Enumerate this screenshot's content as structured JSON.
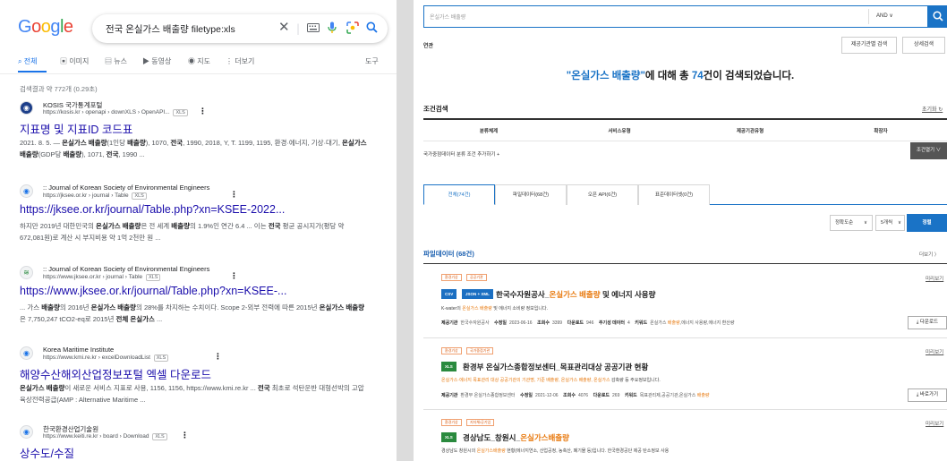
{
  "google": {
    "logo": "Google",
    "logo_colors": [
      "#4285f4",
      "#ea4335",
      "#fbbc05",
      "#4285f4",
      "#34a853",
      "#ea4335"
    ],
    "query": "전국 온실가스 배출량 filetype:xls",
    "icons": [
      "clear-icon",
      "keyboard-icon",
      "mic-icon",
      "lens-icon",
      "search-icon"
    ],
    "tabs": [
      {
        "icon": "search-icon",
        "glyph": "⌕",
        "label": "전체"
      },
      {
        "icon": "image-icon",
        "glyph": "▣",
        "label": "이미지"
      },
      {
        "icon": "news-icon",
        "glyph": "▤",
        "label": "뉴스"
      },
      {
        "icon": "video-icon",
        "glyph": "▶",
        "label": "동영상"
      },
      {
        "icon": "map-pin-icon",
        "glyph": "◉",
        "label": "지도"
      },
      {
        "icon": "more-dots-icon",
        "glyph": "⋮",
        "label": "더보기"
      },
      {
        "icon": "",
        "glyph": "",
        "label": "도구"
      }
    ],
    "stats": "검색결과 약 772개 (0.29초)",
    "results": [
      {
        "site": "KOSIS 국가통계포털",
        "url": "https://kosis.kr › openapi › downXLS › OpenAPI...",
        "filetype": "XLS",
        "title": "지표명 및 지표ID 코드표",
        "snippet_html": "2021. 8. 5. — <b>온실가스 배출량</b>(1인당 <b>배출량</b>), 1070, <b>전국</b>, 1990, 2018, Y, T. 1199, 1195, 환경·에너지, 기상·대기, <b>온실가스 배출량</b>(GDP당 <b>배출량</b>), 1071, <b>전국</b>, 1990 ..."
      },
      {
        "site": ":: Journal of Korean Society of Environmental Engineers",
        "url": "https://jksee.or.kr › journal › Table",
        "filetype": "XLS",
        "title": "https://jksee.or.kr/journal/Table.php?xn=KSEE-2022...",
        "snippet_html": "하지만 2019년 대한민국의 <b>온실가스 배출량</b>은 전 세계 <b>배출량</b>의 1.9%인 연간 6.4 ... 이는 <b>전국</b> 평균 공시지가(평당 약 672,081원)로 계산 시 부지비용 약 1억 2천만 원 ..."
      },
      {
        "site": ":: Journal of Korean Society of Environmental Engineers",
        "url": "https://www.jksee.or.kr › journal › Table",
        "filetype": "XLS",
        "title": "https://www.jksee.or.kr/journal/Table.php?xn=KSEE-...",
        "snippet_html": "... 가스 <b>배출량</b>의 2016년 <b>온실가스 배출량</b>의 28%를 차지하는 수치이다. Scope 2-외부 전력에 따른 2015년 <b>온실가스 배출량</b>은 7,750,247 tCO2-eq로 2015년 <b>전체 온실가스</b> ..."
      },
      {
        "site": "Korea Maritime Institute",
        "url": "https://www.kmi.re.kr › excelDownloadList",
        "filetype": "XLS",
        "title": "해양수산해외산업정보포털 엑셀 다운로드",
        "snippet_html": "<b>온실가스 배출량</b>이 새로운 서비스 지표로 사용, 1156, 1156, https://www.kmi.re.kr ... <b>전국</b> 최초로 석탄운반 대형선박의 고압 육상전력공급(AMP : Alternative Maritime ..."
      },
      {
        "site": "한국환경산업기술원",
        "url": "https://www.keiti.re.kr › board › Download",
        "filetype": "XLS",
        "title": "상수도/수질",
        "snippet_html": ""
      }
    ]
  },
  "portal": {
    "search_placeholder": "온실가스 배출량",
    "operator": "AND ∨",
    "related_label": "연관",
    "btn_org_search": "제공기관별 검색",
    "btn_detail_search": "상세검색",
    "headline_prefix": "\"온실가스 배출량\"",
    "headline_mid": "에 대해 총 ",
    "headline_count": "74",
    "headline_suffix": "건이 검색되었습니다.",
    "cond_title": "조건검색",
    "reset_label": "초기화 ↻",
    "cond_cells": [
      "분류체계",
      "서비스유형",
      "제공기관유형",
      "확장자"
    ],
    "add_condition": "국가중점데이터 분류 조건 추가하기 +",
    "open_conditions": "조건열기 ∨",
    "tabs": [
      "전체(74건)",
      "파일데이터(68건)",
      "오픈 API(6건)",
      "표준데이터셋(0건)"
    ],
    "sort_options": [
      "정확도순",
      "5개씩"
    ],
    "sort_button": "정렬",
    "section_title": "파일데이터 (68건)",
    "more_label": "더보기 〉",
    "preview_label": "미리보기",
    "cards": [
      {
        "tags": [
          "환경기상",
          "공공기관"
        ],
        "formats": [
          "CSV",
          "JSON + XML"
        ],
        "format_colors": [
          "#1b6fc2",
          "#1b6fc2"
        ],
        "title_pre": "한국수자원공사_",
        "title_em": "온실가스 배출량",
        "title_post": " 및 에너지 사용량",
        "desc_pre": "K-water의 ",
        "desc_em": "온실가스 배출량",
        "desc_post": " 및 에너지 소비량 정보입니다.",
        "meta": {
          "org_label": "제공기관",
          "org": "한국수자원공사",
          "date_label": "수정일",
          "date": "2023-06-16",
          "views_label": "조회수",
          "views": "3399",
          "dl_label": "다운로드",
          "dl": "946",
          "extra_label": "주기성 데이터",
          "extra": "4",
          "kw_label": "키워드",
          "kw_pre": "온실가스 ",
          "kw_em": "배출량",
          "kw_post": ",에너지 사용량,에너지 환산량"
        },
        "action": "⤓ 다운로드"
      },
      {
        "tags": [
          "환경기상",
          "국가중점기관"
        ],
        "formats": [
          "XLS"
        ],
        "format_colors": [
          "#2a8a3e"
        ],
        "title_pre": "환경부 온실가스종합정보센터_목표관리대상 공공기관 현황",
        "title_em": "",
        "title_post": "",
        "desc_pre": "온실가스·에너지 목표관리 대상 공공기관의 기관명, 기준 ",
        "desc_em": "배출량, 온실가스 배출량, 온실가스",
        "desc_post": " 감축량 등 주요정보입니다.",
        "meta": {
          "org_label": "제공기관",
          "org": "환경부 온실가스종합정보센터",
          "date_label": "수정일",
          "date": "2021-12-06",
          "views_label": "조회수",
          "views": "4076",
          "dl_label": "다운로드",
          "dl": "269",
          "extra_label": "",
          "extra": "",
          "kw_label": "키워드",
          "kw_pre": "목표관리제,공공기관,온실가스 ",
          "kw_em": "배출량",
          "kw_post": ""
        },
        "action": "⤓ 바로가기"
      },
      {
        "tags": [
          "환경기상",
          "지자체/공기업"
        ],
        "formats": [
          "XLS"
        ],
        "format_colors": [
          "#2a8a3e"
        ],
        "title_pre": "경상남도_창원시_",
        "title_em": "온실가스배출량",
        "title_post": "",
        "desc_pre": "경상남도 창원시의 ",
        "desc_em": "온실가스배출량",
        "desc_post": " 현황(에너지연소, 산업공정, 농축산, 폐기물 등)입니다. 한국환경공단 제공 탄소정보 사용",
        "meta": null,
        "action": ""
      }
    ]
  }
}
